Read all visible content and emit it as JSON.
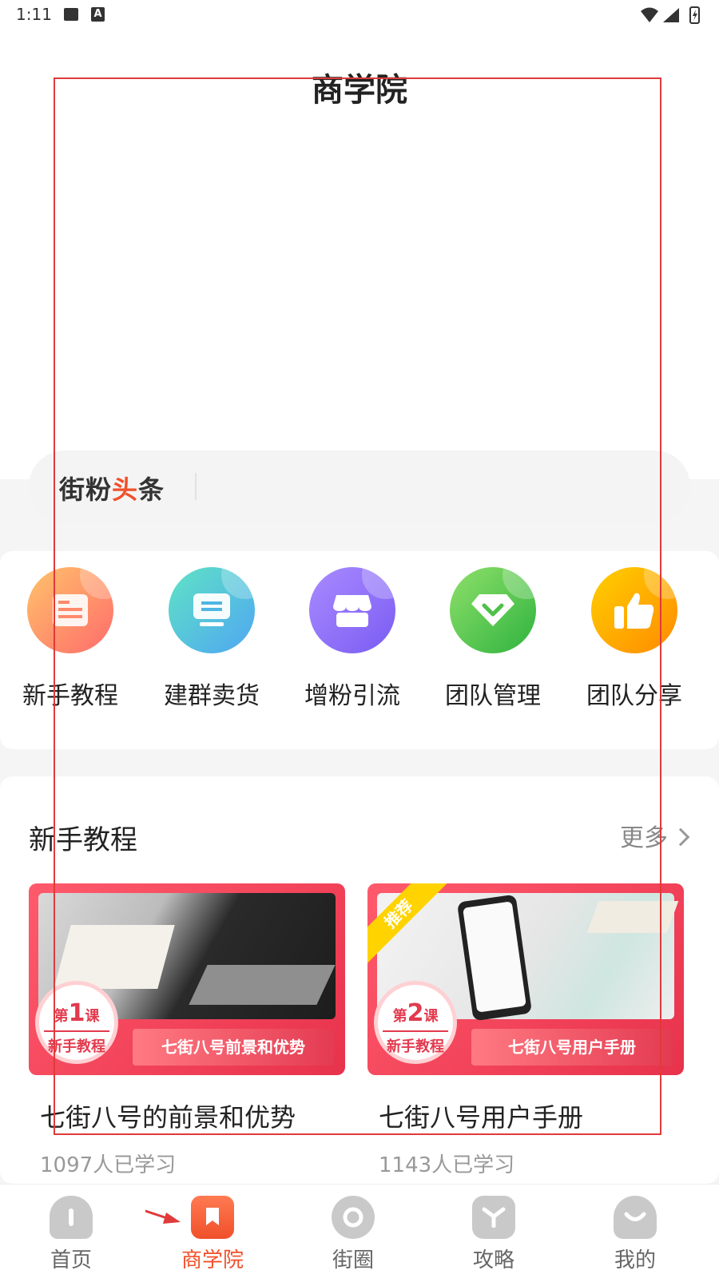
{
  "status_bar": {
    "time": "1:11",
    "a_icon_letter": "A"
  },
  "header": {
    "title": "商学院"
  },
  "news": {
    "logo_main": "街粉",
    "logo_accent": "头",
    "logo_tail": "条"
  },
  "shortcuts": [
    {
      "label": "新手教程",
      "color_from": "#ffc36b",
      "color_to": "#ff6b6b"
    },
    {
      "label": "建群卖货",
      "color_from": "#5fe3c4",
      "color_to": "#4fa6f3"
    },
    {
      "label": "增粉引流",
      "color_from": "#a98bff",
      "color_to": "#7a5cf3"
    },
    {
      "label": "团队管理",
      "color_from": "#8ee06a",
      "color_to": "#2fb33f"
    },
    {
      "label": "团队分享",
      "color_from": "#ffd000",
      "color_to": "#ff8a00"
    }
  ],
  "tutorials": {
    "section_title": "新手教程",
    "more_label": "更多",
    "courses": [
      {
        "lesson_prefix": "第",
        "lesson_num": "1",
        "lesson_suffix": "课",
        "kind": "新手教程",
        "banner": "七街八号前景和优势",
        "tag": "",
        "title": "七街八号的前景和优势",
        "learners": "1097人已学习"
      },
      {
        "lesson_prefix": "第",
        "lesson_num": "2",
        "lesson_suffix": "课",
        "kind": "新手教程",
        "banner": "七街八号用户手册",
        "tag": "推荐",
        "title": "七街八号用户手册",
        "learners": "1143人已学习"
      }
    ]
  },
  "tabbar": {
    "items": [
      {
        "label": "首页",
        "active": false
      },
      {
        "label": "商学院",
        "active": true
      },
      {
        "label": "街圈",
        "active": false
      },
      {
        "label": "攻略",
        "active": false
      },
      {
        "label": "我的",
        "active": false
      }
    ],
    "active_color": "#f0502a"
  },
  "colors": {
    "accent": "#f0502a",
    "highlight": "#e03a3a"
  }
}
